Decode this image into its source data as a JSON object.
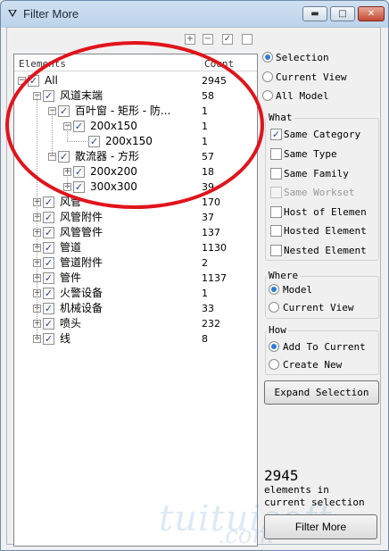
{
  "window": {
    "title": "Filter More",
    "app_icon": "filter-app-icon",
    "min_glyph": "▬",
    "max_glyph": "□",
    "close_glyph": "✕"
  },
  "toolbar": {
    "expand_glyph": "+",
    "collapse_glyph": "−",
    "check_glyph": "✓",
    "uncheck_glyph": ""
  },
  "tree": {
    "col_elements": "Elements",
    "col_count": "Count",
    "rows": [
      {
        "label": "All",
        "count": "2945"
      },
      {
        "label": "风道末端",
        "count": "58"
      },
      {
        "label": "百叶窗 - 矩形 - 防...",
        "count": "1"
      },
      {
        "label": "200x150",
        "count": "1"
      },
      {
        "label": "200x150",
        "count": "1"
      },
      {
        "label": "散流器 - 方形",
        "count": "57"
      },
      {
        "label": "200x200",
        "count": "18"
      },
      {
        "label": "300x300",
        "count": "39"
      },
      {
        "label": "风管",
        "count": "170"
      },
      {
        "label": "风管附件",
        "count": "37"
      },
      {
        "label": "风管管件",
        "count": "137"
      },
      {
        "label": "管道",
        "count": "1130"
      },
      {
        "label": "管道附件",
        "count": "2"
      },
      {
        "label": "管件",
        "count": "1137"
      },
      {
        "label": "火警设备",
        "count": "1"
      },
      {
        "label": "机械设备",
        "count": "33"
      },
      {
        "label": "喷头",
        "count": "232"
      },
      {
        "label": "线",
        "count": "8"
      }
    ]
  },
  "scope": {
    "selection": "Selection",
    "current_view": "Current View",
    "all_model": "All Model"
  },
  "what": {
    "title": "What",
    "same_category": "Same Category",
    "same_type": "Same Type",
    "same_family": "Same Family",
    "same_workset": "Same Workset",
    "host_of_elements": "Host of Elemen",
    "hosted_element": "Hosted Element",
    "nested_element": "Nested Element"
  },
  "where": {
    "title": "Where",
    "model": "Model",
    "current_view": "Current View"
  },
  "how": {
    "title": "How",
    "add_to_current": "Add To Current",
    "create_new": "Create New"
  },
  "expand_selection": "Expand Selection",
  "summary": {
    "count": "2945",
    "line1": "elements in",
    "line2": "current selection"
  },
  "filter_more": "Filter More",
  "watermark": {
    "main": "tuituisoft",
    "sub": ".com"
  },
  "colors": {
    "annotation_oval": "#e1141b",
    "radio_dot": "#2c7bd6"
  }
}
